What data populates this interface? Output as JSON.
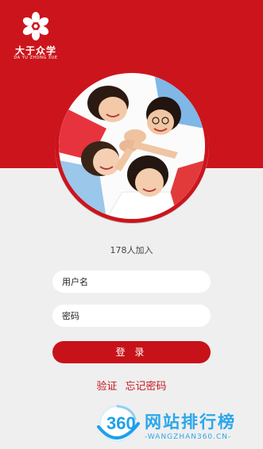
{
  "brand": {
    "name_cn": "大于众学",
    "name_en": "DA YU ZHONG XUE",
    "color": "#cc141c",
    "logo_icon": "flower-logo-icon"
  },
  "hero": {
    "photo": "group-of-students-photo"
  },
  "join": {
    "text": "178人加入"
  },
  "form": {
    "username_placeholder": "用户名",
    "password_placeholder": "密码",
    "login_label": "登 录"
  },
  "links": {
    "verify": "验证",
    "forgot": "忘记密码"
  },
  "watermark": {
    "number": "360",
    "title": "网站排行榜",
    "subtitle": "-WANGZHAN360.CN-",
    "color": "#2aa6ec"
  }
}
